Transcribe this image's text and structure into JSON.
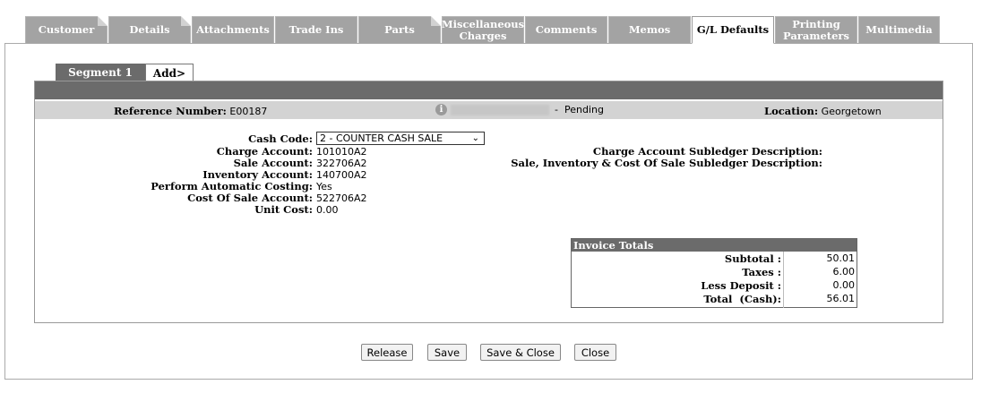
{
  "tabs": [
    {
      "label": "Customer",
      "fold": true
    },
    {
      "label": "Details",
      "fold": true
    },
    {
      "label": "Attachments",
      "fold": false
    },
    {
      "label": "Trade Ins",
      "fold": false
    },
    {
      "label": "Parts",
      "fold": true
    },
    {
      "label": "Miscellaneous Charges",
      "fold": false
    },
    {
      "label": "Comments",
      "fold": false
    },
    {
      "label": "Memos",
      "fold": false
    },
    {
      "label": "G/L Defaults",
      "fold": false,
      "active": true
    },
    {
      "label": "Printing Parameters",
      "fold": false
    },
    {
      "label": "Multimedia",
      "fold": false
    }
  ],
  "segment": {
    "active_label": "Segment 1",
    "add_label": "Add>"
  },
  "reference": {
    "number_label": "Reference Number:",
    "number_value": "E00187",
    "status": "Pending",
    "location_label": "Location:",
    "location_value": "Georgetown"
  },
  "fields": {
    "cash_code_label": "Cash Code:",
    "cash_code_value": "2 - COUNTER CASH SALE",
    "charge_account_label": "Charge Account:",
    "charge_account_value": "101010A2",
    "sale_account_label": "Sale Account:",
    "sale_account_value": "322706A2",
    "inventory_account_label": "Inventory Account:",
    "inventory_account_value": "140700A2",
    "auto_costing_label": "Perform Automatic Costing:",
    "auto_costing_value": "Yes",
    "cost_of_sale_label": "Cost Of Sale Account:",
    "cost_of_sale_value": "522706A2",
    "unit_cost_label": "Unit Cost:",
    "unit_cost_value": "0.00",
    "charge_subledger_label": "Charge Account Subledger Description:",
    "sale_subledger_label": "Sale, Inventory & Cost Of Sale Subledger Description:"
  },
  "totals": {
    "title": "Invoice Totals",
    "subtotal_label": "Subtotal :",
    "subtotal_value": "50.01",
    "taxes_label": "Taxes :",
    "taxes_value": "6.00",
    "deposit_label": "Less Deposit :",
    "deposit_value": "0.00",
    "total_label": "Total  (Cash):",
    "total_value": "56.01"
  },
  "buttons": {
    "release": "Release",
    "save": "Save",
    "save_close": "Save & Close",
    "close": "Close"
  }
}
